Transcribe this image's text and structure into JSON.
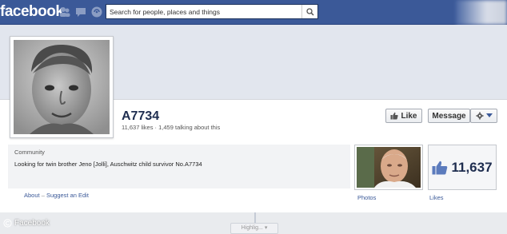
{
  "topbar": {
    "logo": "facebook",
    "search_placeholder": "Search for people, places and things",
    "icons": [
      "friend-requests-icon",
      "messages-icon",
      "notifications-icon",
      "search-icon"
    ]
  },
  "page": {
    "name": "A7734",
    "stats": "11,637 likes · 1,459 talking about this",
    "like_label": "Like",
    "message_label": "Message"
  },
  "about": {
    "category": "Community",
    "description": "Looking for twin brother Jeno [Jolli], Auschwitz child survivor No.A7734",
    "about_link": "About",
    "separator": "–",
    "suggest_link": "Suggest an Edit"
  },
  "tiles": {
    "photos_label": "Photos",
    "likes_count": "11,637",
    "likes_label": "Likes"
  },
  "timeline": {
    "highlights_label": "Highlig..."
  },
  "credit": {
    "text": "Facebook"
  },
  "colors": {
    "brand_blue": "#3b5998",
    "link_blue": "#3b5998",
    "header_bg": "#ffffff"
  }
}
